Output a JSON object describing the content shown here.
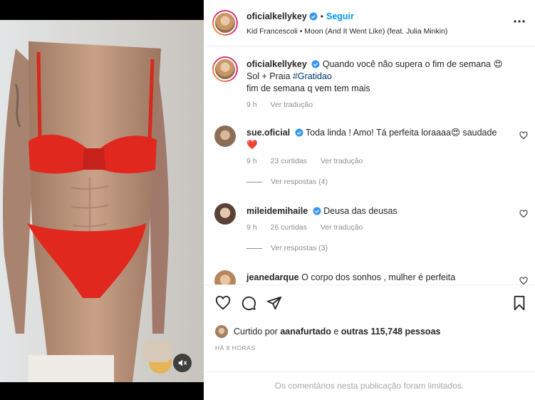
{
  "post": {
    "username": "oficialkellykey",
    "follow_label": "Seguir",
    "music": "Kid Francescoli • Moon (And It Went Like) (feat. Julia Minkin)"
  },
  "caption": {
    "username": "oficialkellykey",
    "line1": "Quando você não supera o fim de semana 😍",
    "line2_prefix": "Sol + Praia ",
    "hashtag": "#Gratidao",
    "line3": "fim de semana q vem tem mais",
    "time": "9 h",
    "translate": "Ver tradução"
  },
  "comments": [
    {
      "username": "sue.oficial",
      "text": "Toda linda ! Amo! Tá perfeita loraaaa😍 saudade",
      "text2": "❤️",
      "time": "9 h",
      "likes": "23 curtidas",
      "translate": "Ver tradução",
      "replies": "Ver respostas (4)"
    },
    {
      "username": "mileidemihaile",
      "text": "Deusa das deusas",
      "time": "9 h",
      "likes": "26 curtidas",
      "translate": "Ver tradução",
      "replies": "Ver respostas (3)"
    },
    {
      "username": "jeanedarque",
      "text": "O corpo dos sonhos , mulher é perfeita"
    }
  ],
  "likes": {
    "prefix": "Curtido por",
    "user": "aanafurtado",
    "middle": "e",
    "others": "outras 115,748 pessoas"
  },
  "timestamp": "HÁ 9 HORAS",
  "limited_notice": "Os comentários nesta publicação foram limitados.",
  "colors": {
    "accent": "#0095f6",
    "verified": "#3897f0",
    "hashtag": "#00376b",
    "bikini": "#e0281f",
    "heart": "#ed4956"
  }
}
